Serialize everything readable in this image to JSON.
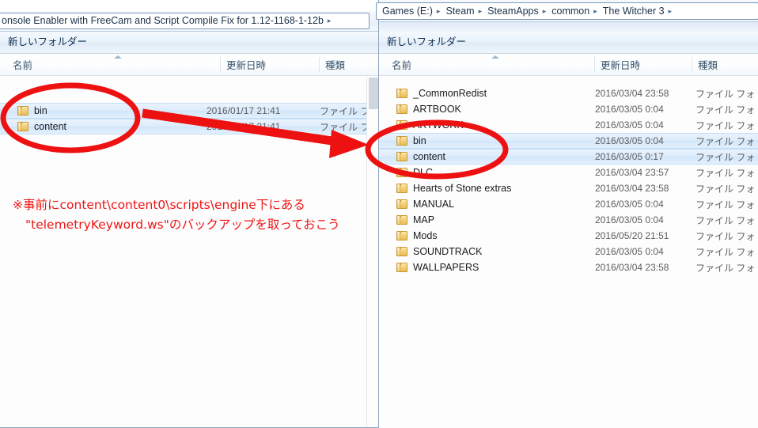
{
  "left_window": {
    "breadcrumb_text": "onsole Enabler with FreeCam and Script Compile Fix for 1.12-1168-1-12b",
    "breadcrumb_arrow": "▸",
    "toolbar": {
      "new_folder_label": "新しいフォルダー"
    },
    "columns": {
      "name": "名前",
      "date": "更新日時",
      "type": "種類"
    },
    "rows": [
      {
        "name": "bin",
        "date": "2016/01/17 21:41",
        "type": "ファイル フォ",
        "selected": true
      },
      {
        "name": "content",
        "date": "2016/01/17 21:41",
        "type": "ファイル フォ",
        "selected": true
      }
    ]
  },
  "right_window": {
    "breadcrumb": [
      {
        "label": "Games (E:)"
      },
      {
        "label": "Steam"
      },
      {
        "label": "SteamApps"
      },
      {
        "label": "common"
      },
      {
        "label": "The Witcher 3"
      }
    ],
    "breadcrumb_arrow": "▸",
    "toolbar": {
      "new_folder_label": "新しいフォルダー"
    },
    "columns": {
      "name": "名前",
      "date": "更新日時",
      "type": "種類"
    },
    "rows": [
      {
        "name": "_CommonRedist",
        "date": "2016/03/04 23:58",
        "type": "ファイル フォ",
        "selected": false
      },
      {
        "name": "ARTBOOK",
        "date": "2016/03/05 0:04",
        "type": "ファイル フォ",
        "selected": false
      },
      {
        "name": "ARTWORK",
        "date": "2016/03/05 0:04",
        "type": "ファイル フォ",
        "selected": false
      },
      {
        "name": "bin",
        "date": "2016/03/05 0:04",
        "type": "ファイル フォ",
        "selected": true
      },
      {
        "name": "content",
        "date": "2016/03/05 0:17",
        "type": "ファイル フォ",
        "selected": true
      },
      {
        "name": "DLC",
        "date": "2016/03/04 23:57",
        "type": "ファイル フォ",
        "selected": false
      },
      {
        "name": "Hearts of Stone extras",
        "date": "2016/03/04 23:58",
        "type": "ファイル フォ",
        "selected": false
      },
      {
        "name": "MANUAL",
        "date": "2016/03/05 0:04",
        "type": "ファイル フォ",
        "selected": false
      },
      {
        "name": "MAP",
        "date": "2016/03/05 0:04",
        "type": "ファイル フォ",
        "selected": false
      },
      {
        "name": "Mods",
        "date": "2016/05/20 21:51",
        "type": "ファイル フォ",
        "selected": false
      },
      {
        "name": "SOUNDTRACK",
        "date": "2016/03/05 0:04",
        "type": "ファイル フォ",
        "selected": false
      },
      {
        "name": "WALLPAPERS",
        "date": "2016/03/04 23:58",
        "type": "ファイル フォ",
        "selected": false
      }
    ]
  },
  "annotations": {
    "note_line1": "※事前にcontent\\content0\\scripts\\engine下にある",
    "note_line2": "\"telemetryKeyword.ws\"のバックアップを取っておこう",
    "highlight_color": "#ee1111"
  }
}
